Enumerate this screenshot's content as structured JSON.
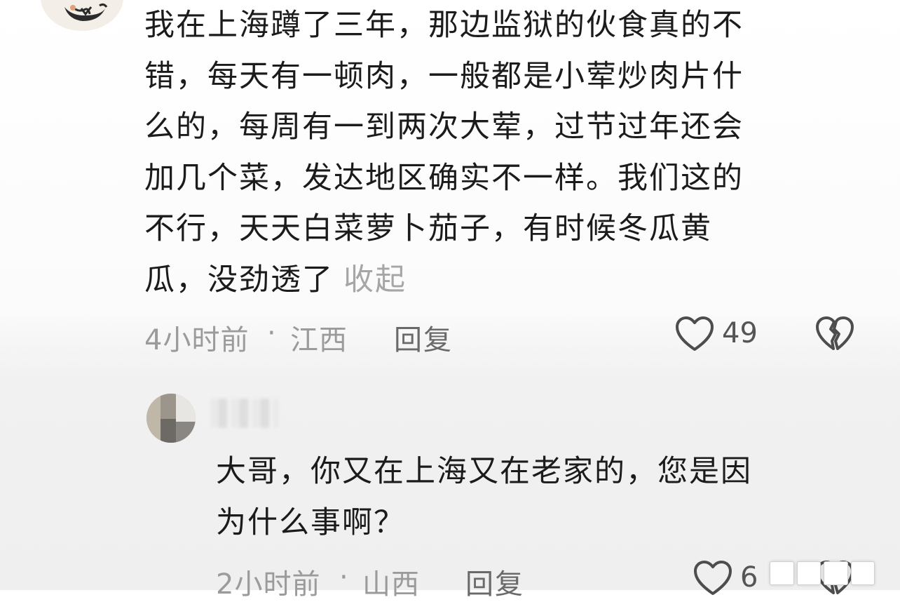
{
  "comment1": {
    "avatar_icon": "user-avatar-illustration",
    "lines": [
      "我在上海蹲了三年，那边监狱的伙食真的不",
      "错，每天有一顿肉，一般都是小荤炒肉片什",
      "么的，每周有一到两次大荤，过节过年还会",
      "加几个菜，发达地区确实不一样。我们这的",
      "不行，天天白菜萝卜茄子，有时候冬瓜黄",
      "瓜，没劲透了"
    ],
    "collapse_label": "收起",
    "time": "4小时前",
    "separator": "·",
    "location": "江西",
    "reply_label": "回复",
    "like_count": "49",
    "like_icon": "heart-outline-icon",
    "dislike_icon": "broken-heart-icon"
  },
  "comment2": {
    "avatar_icon": "blurred-user-avatar",
    "username_blurred": true,
    "lines": [
      "大哥，你又在上海又在老家的，您是因",
      "为什么事啊？"
    ],
    "time": "2小时前",
    "separator": "·",
    "location": "山西",
    "reply_label": "回复",
    "like_count": "6",
    "like_icon": "heart-outline-icon",
    "dislike_icon": "broken-heart-icon"
  },
  "colors": {
    "text": "#1b1b1b",
    "meta": "#9b9b9b",
    "collapse": "#a6a6a6"
  }
}
